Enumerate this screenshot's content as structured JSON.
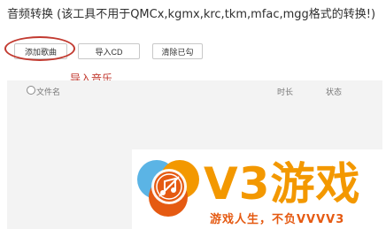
{
  "header": {
    "title": "音频转换 (该工具不用于QMCx,kgmx,krc,tkm,mfac,mgg格式的转换!)"
  },
  "toolbar": {
    "add_label": "添加歌曲",
    "import_cd_label": "导入CD",
    "clear_label": "清除已勾"
  },
  "annotation": {
    "text": "导入音乐",
    "color": "#c23a30"
  },
  "list": {
    "columns": {
      "name": "文件名",
      "duration": "时长",
      "status": "状态"
    }
  },
  "watermark": {
    "brand": "V3游戏",
    "slogan": "游戏人生，不负VVVV3",
    "colors": {
      "orange": "#f39800",
      "red": "#e55a12",
      "blue": "#5bb4e5"
    },
    "icon": "music-disc-icon"
  }
}
